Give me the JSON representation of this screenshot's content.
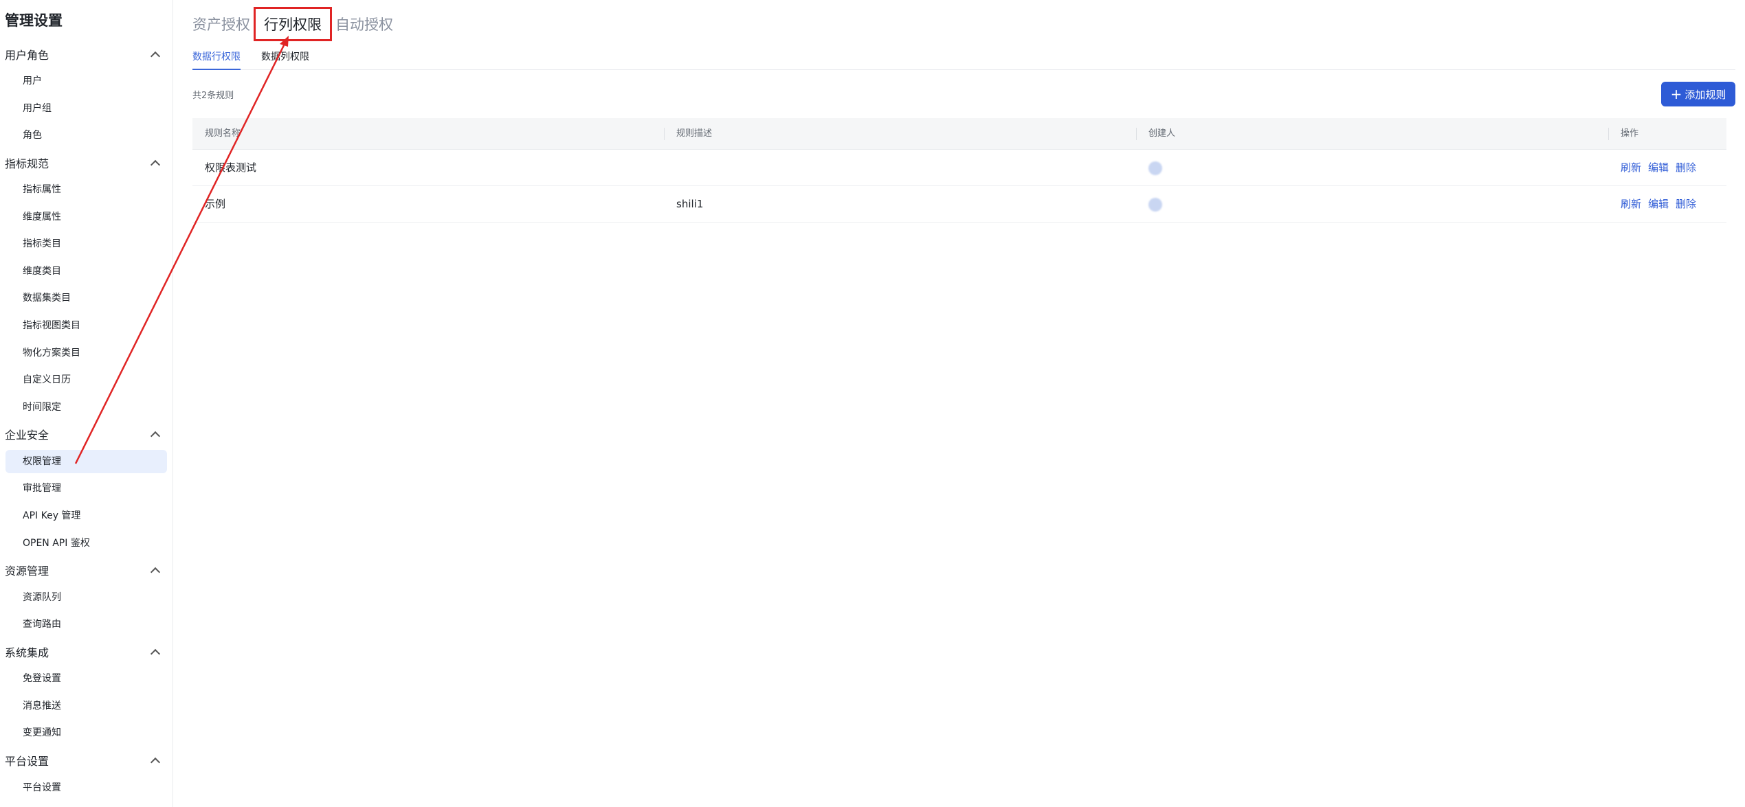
{
  "sidebar": {
    "title": "管理设置",
    "groups": [
      {
        "label": "用户角色",
        "items": [
          "用户",
          "用户组",
          "角色"
        ]
      },
      {
        "label": "指标规范",
        "items": [
          "指标属性",
          "维度属性",
          "指标类目",
          "维度类目",
          "数据集类目",
          "指标视图类目",
          "物化方案类目",
          "自定义日历",
          "时间限定"
        ]
      },
      {
        "label": "企业安全",
        "items": [
          "权限管理",
          "审批管理",
          "API Key 管理",
          "OPEN API 鉴权"
        ]
      },
      {
        "label": "资源管理",
        "items": [
          "资源队列",
          "查询路由"
        ]
      },
      {
        "label": "系统集成",
        "items": [
          "免登设置",
          "消息推送",
          "变更通知"
        ]
      },
      {
        "label": "平台设置",
        "items": [
          "平台设置"
        ]
      }
    ],
    "active_item": "权限管理"
  },
  "top_tabs": [
    "资产授权",
    "行列权限",
    "自动授权"
  ],
  "active_top_tab": "行列权限",
  "sub_tabs": [
    "数据行权限",
    "数据列权限"
  ],
  "active_sub_tab": "数据行权限",
  "rule_count": "共2条规则",
  "add_button": {
    "icon": "plus-icon",
    "label": "添加规则"
  },
  "table": {
    "columns": [
      "规则名称",
      "规则描述",
      "创建人",
      "操作"
    ],
    "rows": [
      {
        "name": "权限表测试",
        "desc": "",
        "creator": ""
      },
      {
        "name": "示例",
        "desc": "shili1",
        "creator": ""
      }
    ],
    "actions": [
      "刷新",
      "编辑",
      "删除"
    ]
  },
  "colors": {
    "primary": "#2e5bd6",
    "annotation": "#e02424",
    "active_bg": "#e8effd"
  }
}
